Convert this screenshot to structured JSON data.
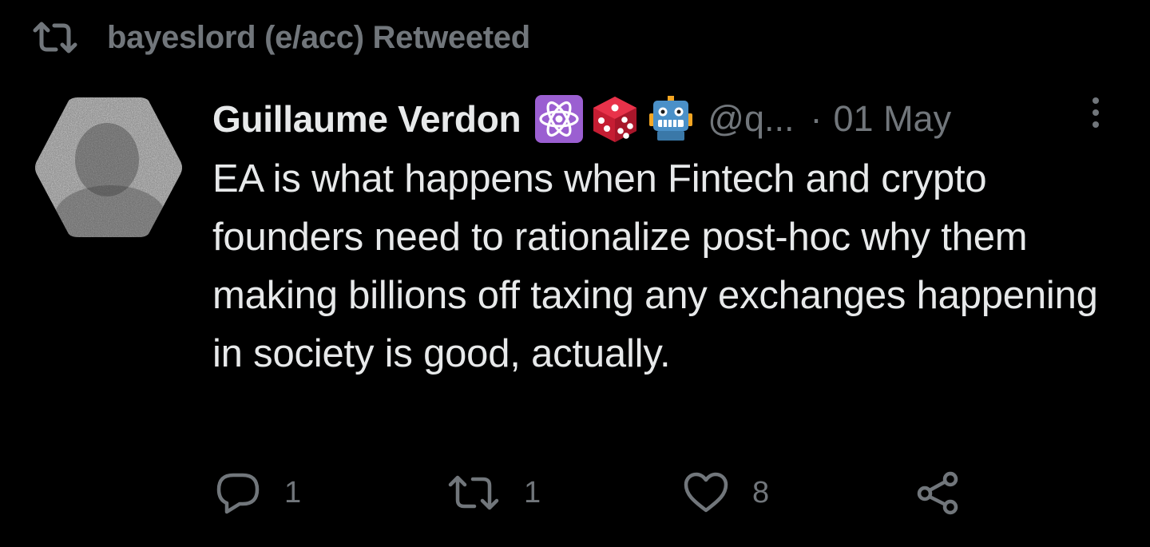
{
  "retweet_header": {
    "text": "bayeslord (e/acc) Retweeted",
    "icon": "retweet-icon"
  },
  "tweet": {
    "author": {
      "display_name": "Guillaume Verdon",
      "handle": "@q...",
      "badges": [
        "atom-emoji-icon",
        "die-emoji-icon",
        "robot-emoji-icon"
      ],
      "avatar": "avatar-image"
    },
    "separator": "·",
    "date": "01 May",
    "text": "EA is what happens when Fintech and crypto founders need to rationalize post-hoc why them making billions off taxing any exchanges happening in society is good, actually.",
    "actions": {
      "reply_count": "1",
      "retweet_count": "1",
      "like_count": "8"
    }
  },
  "colors": {
    "background": "#000000",
    "primary_text": "#e7e9ea",
    "secondary_text": "#71767b",
    "atom_badge": "#9b5fd1",
    "die_badge": "#d8233b",
    "robot_badge": "#4a90c8"
  }
}
